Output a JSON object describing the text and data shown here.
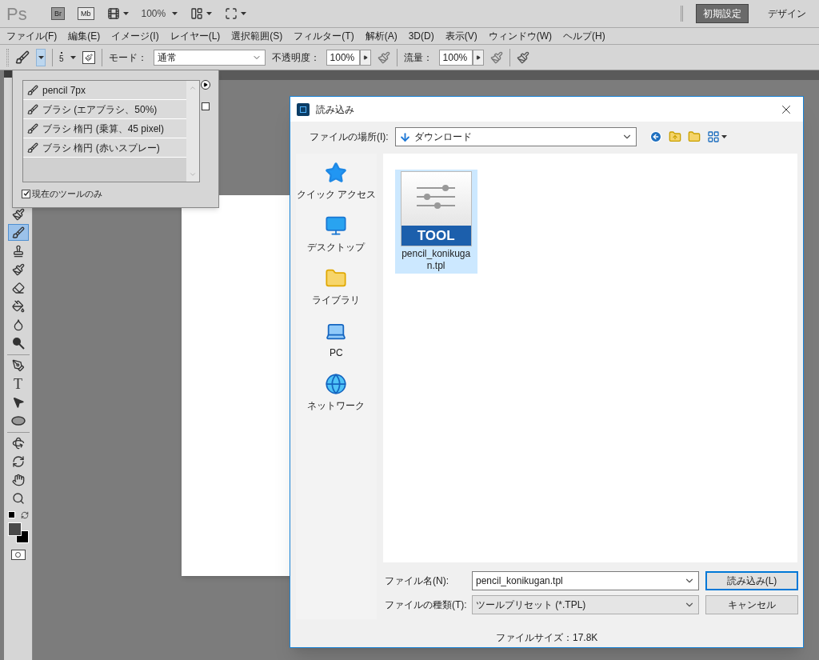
{
  "app_bar": {
    "logo": "Ps",
    "bridge": "Br",
    "mini_bridge": "Mb",
    "zoom": "100%",
    "workspaces": [
      {
        "label": "初期設定",
        "selected": true
      },
      {
        "label": "デザイン",
        "selected": false
      }
    ]
  },
  "menu": [
    "ファイル(F)",
    "編集(E)",
    "イメージ(I)",
    "レイヤー(L)",
    "選択範囲(S)",
    "フィルター(T)",
    "解析(A)",
    "3D(D)",
    "表示(V)",
    "ウィンドウ(W)",
    "ヘルプ(H)"
  ],
  "options_bar": {
    "brush_size": "5",
    "mode_label": "モード：",
    "mode": "通常",
    "opacity_label": "不透明度：",
    "opacity": "100%",
    "flow_label": "流量：",
    "flow": "100%"
  },
  "preset_popup": {
    "items": [
      "pencil 7px",
      "ブラシ (エアブラシ、50%)",
      "ブラシ 楕円 (乗算、45 pixel)",
      "ブラシ 楕円 (赤いスプレー)"
    ],
    "current_tool_only": {
      "label": "現在のツールのみ",
      "checked": true
    }
  },
  "tools": [
    {
      "kind": "mixer",
      "selected": false
    },
    {
      "kind": "brush",
      "selected": true
    },
    {
      "kind": "stamp",
      "selected": false
    },
    {
      "kind": "history",
      "selected": false
    },
    {
      "kind": "eraser",
      "selected": false
    },
    {
      "kind": "bucket",
      "selected": false
    },
    {
      "kind": "drop",
      "selected": false
    },
    {
      "kind": "dodge",
      "selected": false
    },
    {
      "kind": "pen",
      "selected": false
    },
    {
      "kind": "type",
      "selected": false,
      "label": "T"
    },
    {
      "kind": "pointer",
      "selected": false
    },
    {
      "kind": "ellipse",
      "selected": false
    },
    {
      "kind": "rotate",
      "selected": false
    },
    {
      "kind": "orbit",
      "selected": false
    },
    {
      "kind": "hand",
      "selected": false
    },
    {
      "kind": "zoom",
      "selected": false
    }
  ],
  "dialog": {
    "title": "読み込み",
    "location_label": "ファイルの場所(I):",
    "location": "ダウンロード",
    "places": [
      {
        "kind": "quick",
        "label": "クイック アクセス"
      },
      {
        "kind": "desktop",
        "label": "デスクトップ"
      },
      {
        "kind": "library",
        "label": "ライブラリ"
      },
      {
        "kind": "pc",
        "label": "PC"
      },
      {
        "kind": "network",
        "label": "ネットワーク"
      }
    ],
    "files": [
      {
        "name": "pencil_konikugan.tpl",
        "badge": "TOOL",
        "selected": true
      }
    ],
    "filename_label": "ファイル名(N):",
    "filename": "pencil_konikugan.tpl",
    "filetype_label": "ファイルの種類(T):",
    "filetype": "ツールプリセット (*.TPL)",
    "buttons": [
      "読み込み(L)",
      "キャンセル"
    ],
    "file_size": "ファイルサイズ：17.8K"
  }
}
